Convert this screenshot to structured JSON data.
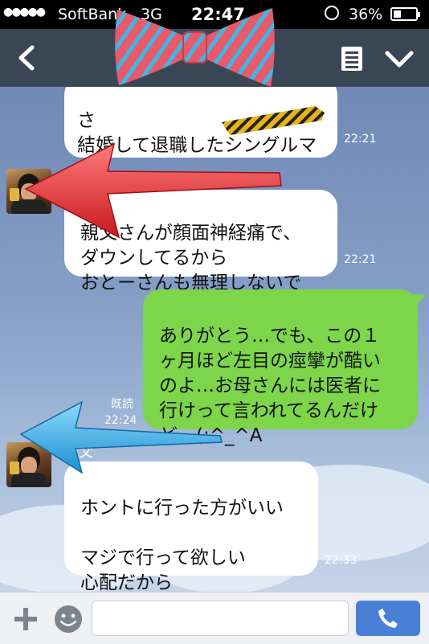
{
  "status_bar": {
    "signal_dots": "●●●●●",
    "carrier": "SoftBank",
    "network": "3G",
    "time": "22:47",
    "battery_percent": "36%",
    "battery_level": 0.36
  },
  "nav": {
    "back_icon": "chevron-left-icon",
    "notes_icon": "notes-icon",
    "menu_icon": "chevron-down-icon"
  },
  "messages": [
    {
      "side": "in",
      "text": "さ\n結婚して退職したシングルマザ\nーの子",
      "time": "22:21"
    },
    {
      "side": "in",
      "text": "親父さんが顔面神経痛で、\nダウンしてるから\nおとーさんも無理しないで",
      "time": "22:21"
    },
    {
      "side": "out",
      "text": "ありがとう…でも、この１\nヶ月ほど左目の痙攣が酷い\nのよ…お母さんには医者に\n行けって言われてるんだけ\nど…(;^_^A",
      "read": "既読",
      "time": "22:24"
    },
    {
      "side": "in",
      "sender": "親父",
      "text": "ホントに行った方がいい\n\nマジで行って欲しい\n心配だから",
      "time": "22:33"
    }
  ],
  "composer": {
    "placeholder": "",
    "plus_icon": "plus-icon",
    "emoji_icon": "smiley-icon",
    "send_icon": "phone-icon"
  },
  "colors": {
    "navbar": "#3a4656",
    "incoming_bubble": "#ffffff",
    "outgoing_bubble": "#7dd54a",
    "call_button": "#4a7fd6",
    "red_arrow": "#e8272c",
    "blue_arrow": "#2aa6e3"
  }
}
